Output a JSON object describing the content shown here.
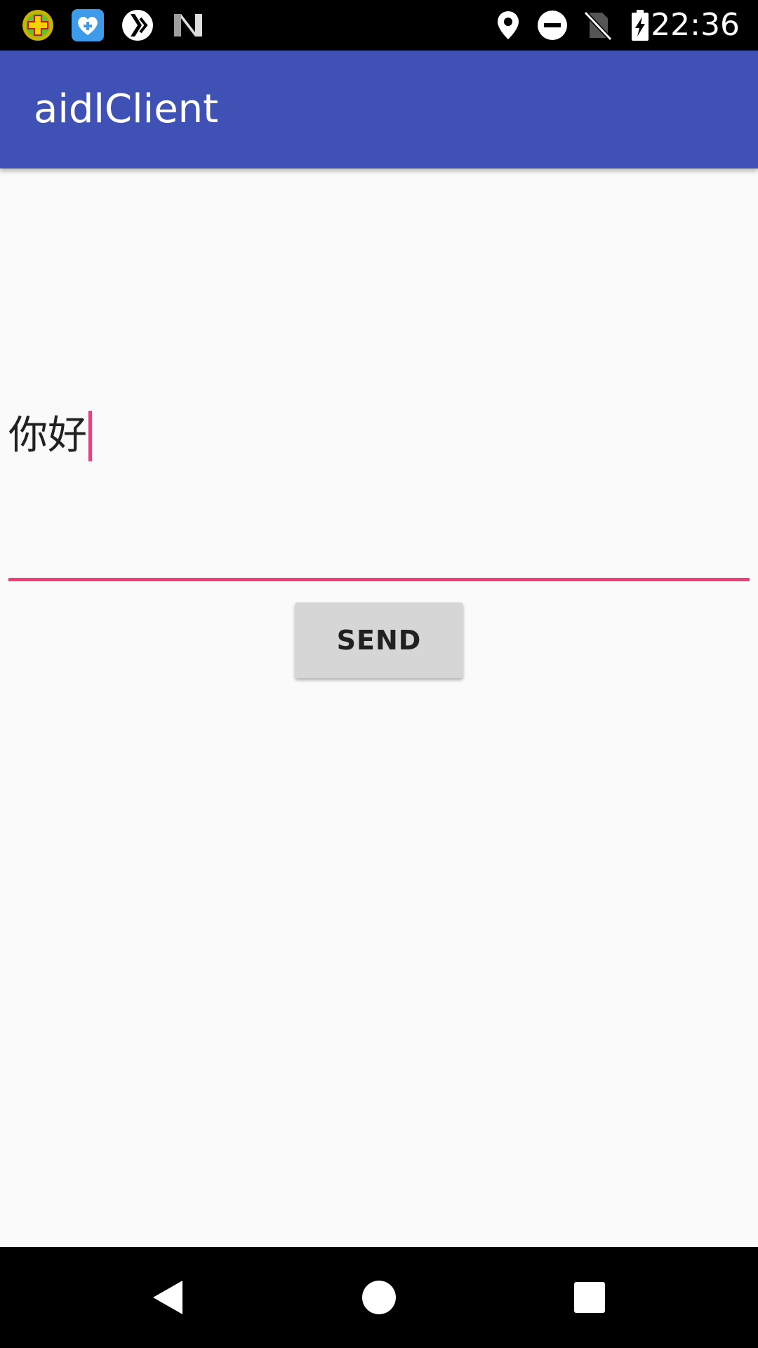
{
  "status_bar": {
    "time": "22:36",
    "left_icons": [
      "app-notification-icon",
      "health-app-icon",
      "sync-icon",
      "n-logo-icon"
    ],
    "right_icons": [
      "location-icon",
      "do-not-disturb-icon",
      "no-sim-icon",
      "battery-charging-icon"
    ]
  },
  "app_bar": {
    "title": "aidlClient",
    "color": "#3f51b5"
  },
  "form": {
    "message_value": "你好",
    "accent_color": "#ec407a",
    "send_label": "SEND"
  },
  "nav_bar": {
    "buttons": [
      "back-icon",
      "home-icon",
      "recents-icon"
    ]
  }
}
